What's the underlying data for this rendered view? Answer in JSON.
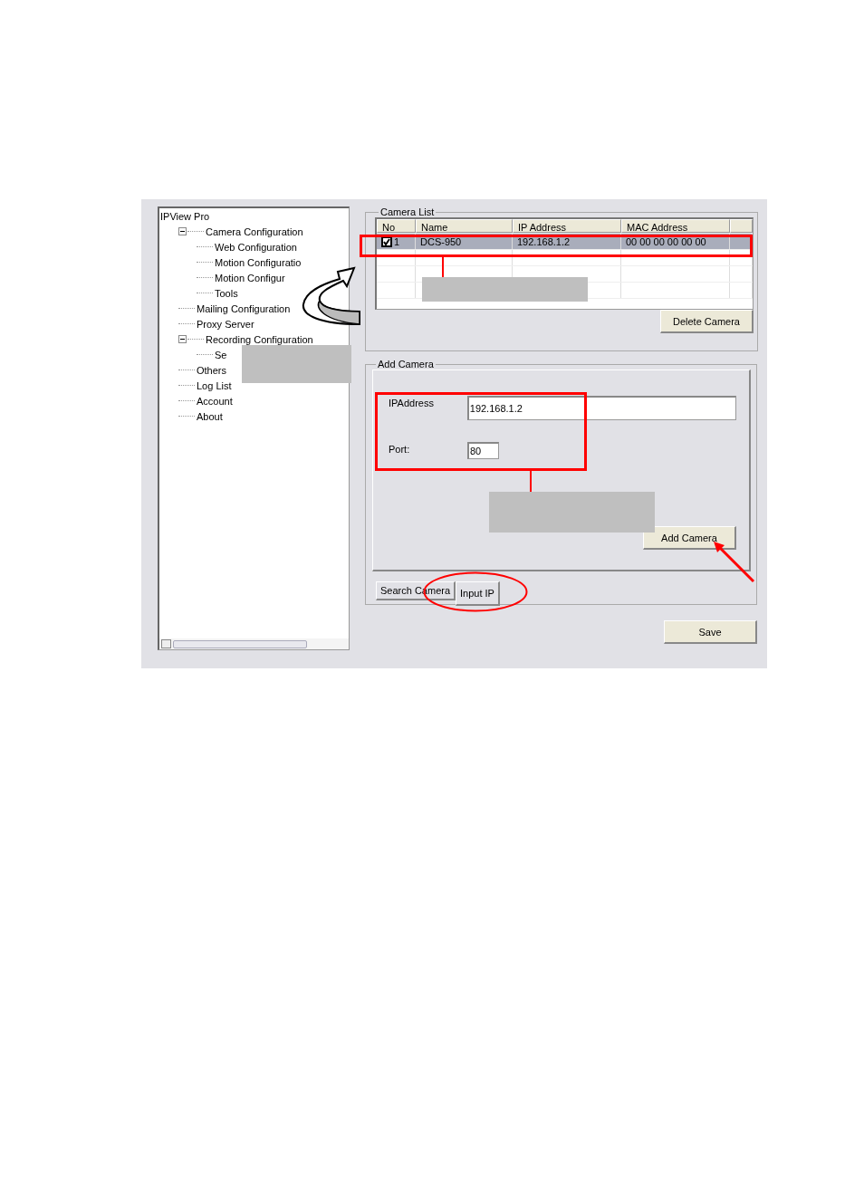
{
  "tree": {
    "label": "IPView Pro",
    "children": [
      {
        "label": "Camera Configuration",
        "expanded": true,
        "children": [
          {
            "label": "Web Configuration"
          },
          {
            "label": "Motion Configuratio"
          },
          {
            "label": "Motion Configur"
          },
          {
            "label": "Tools"
          }
        ]
      },
      {
        "label": "Mailing Configuration"
      },
      {
        "label": "Proxy Server"
      },
      {
        "label": "Recording Configuration",
        "expanded": true,
        "children": [
          {
            "label": "Se"
          }
        ]
      },
      {
        "label": "Others"
      },
      {
        "label": "Log List"
      },
      {
        "label": "Account"
      },
      {
        "label": "About"
      }
    ]
  },
  "camera_list": {
    "title": "Camera List",
    "columns": [
      "No",
      "Name",
      "IP Address",
      "MAC Address"
    ],
    "rows": [
      {
        "no": "1",
        "name": "DCS-950",
        "ip": "192.168.1.2",
        "mac": "00 00 00 00 00 00",
        "checked": true,
        "selected": true
      }
    ],
    "delete_button": "Delete Camera"
  },
  "add_camera": {
    "title": "Add Camera",
    "ip_label": "IPAddress",
    "ip_value": "192.168.1.2",
    "port_label": "Port:",
    "port_value": "80",
    "add_button": "Add Camera",
    "tabs": [
      {
        "label": "Search Camera",
        "selected": false
      },
      {
        "label": "Input IP",
        "selected": true
      }
    ]
  },
  "save_button": "Save"
}
